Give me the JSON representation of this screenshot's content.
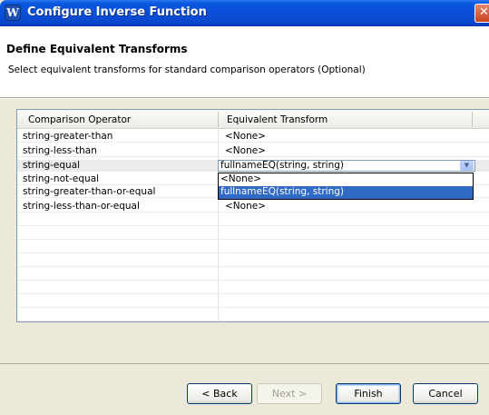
{
  "window": {
    "title": "Configure Inverse Function",
    "close_glyph": "✕",
    "app_icon_letter": "W"
  },
  "header": {
    "title": "Define Equivalent Transforms",
    "description": "Select equivalent transforms for standard comparison operators (Optional)"
  },
  "table": {
    "columns": [
      "Comparison Operator",
      "Equivalent Transform"
    ],
    "rows": [
      {
        "operator": "string-greater-than",
        "transform": "<None>"
      },
      {
        "operator": "string-less-than",
        "transform": "<None>"
      },
      {
        "operator": "string-equal",
        "transform": "fullnameEQ(string, string)"
      },
      {
        "operator": "string-not-equal",
        "transform": "<None>"
      },
      {
        "operator": "string-greater-than-or-equal",
        "transform": "<None>"
      },
      {
        "operator": "string-less-than-or-equal",
        "transform": "<None>"
      }
    ],
    "selected_row": 2
  },
  "editor": {
    "value": "fullnameEQ(string, string)",
    "arrow_glyph": "▼",
    "options": [
      "<None>",
      "fullnameEQ(string, string)"
    ],
    "highlighted_option": 1
  },
  "buttons": {
    "back": "< Back",
    "next": "Next >",
    "finish": "Finish",
    "cancel": "Cancel"
  },
  "colors": {
    "titlebar": "#0a4fd9",
    "selection": "#316ac5",
    "dialog_bg": "#ece9d8"
  }
}
